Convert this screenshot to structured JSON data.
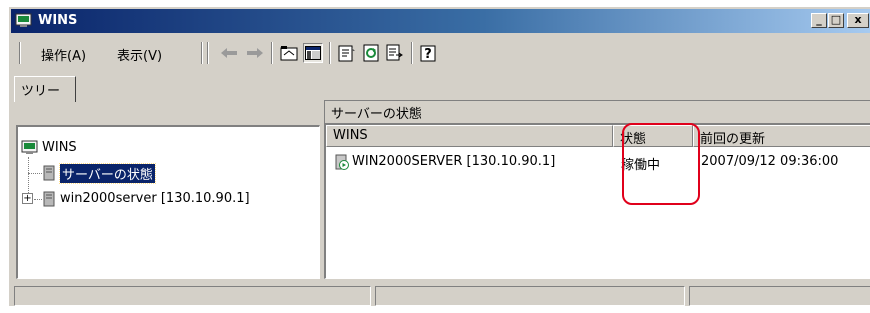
{
  "window": {
    "title": "WINS"
  },
  "title_buttons": {
    "minimize": "_",
    "maximize": "□",
    "close": "x"
  },
  "menubar": {
    "items": [
      {
        "label": "操作(A)"
      },
      {
        "label": "表示(V)"
      }
    ]
  },
  "toolbar": {
    "icons": [
      "back-arrow-icon",
      "forward-arrow-icon",
      "up-folder-icon",
      "show-hide-tree-icon",
      "properties-icon",
      "refresh-icon",
      "export-list-icon",
      "help-icon"
    ]
  },
  "tree": {
    "tab_label": "ツリー",
    "root": "WINS",
    "items": [
      {
        "label": "サーバーの状態",
        "selected": true
      },
      {
        "label": "win2000server [130.10.90.1]",
        "expander": "⊞"
      }
    ]
  },
  "details": {
    "header": "サーバーの状態",
    "columns": [
      "WINS",
      "状態",
      "前回の更新"
    ],
    "rows": [
      {
        "server": "WIN2000SERVER [130.10.90.1]",
        "status": "稼働中",
        "last_update": "2007/09/12 09:36:00"
      }
    ]
  },
  "colors": {
    "titlebar_start": "#0a246a",
    "titlebar_end": "#a6caf0",
    "highlight": "#e0001b",
    "selection": "#0a246a"
  }
}
